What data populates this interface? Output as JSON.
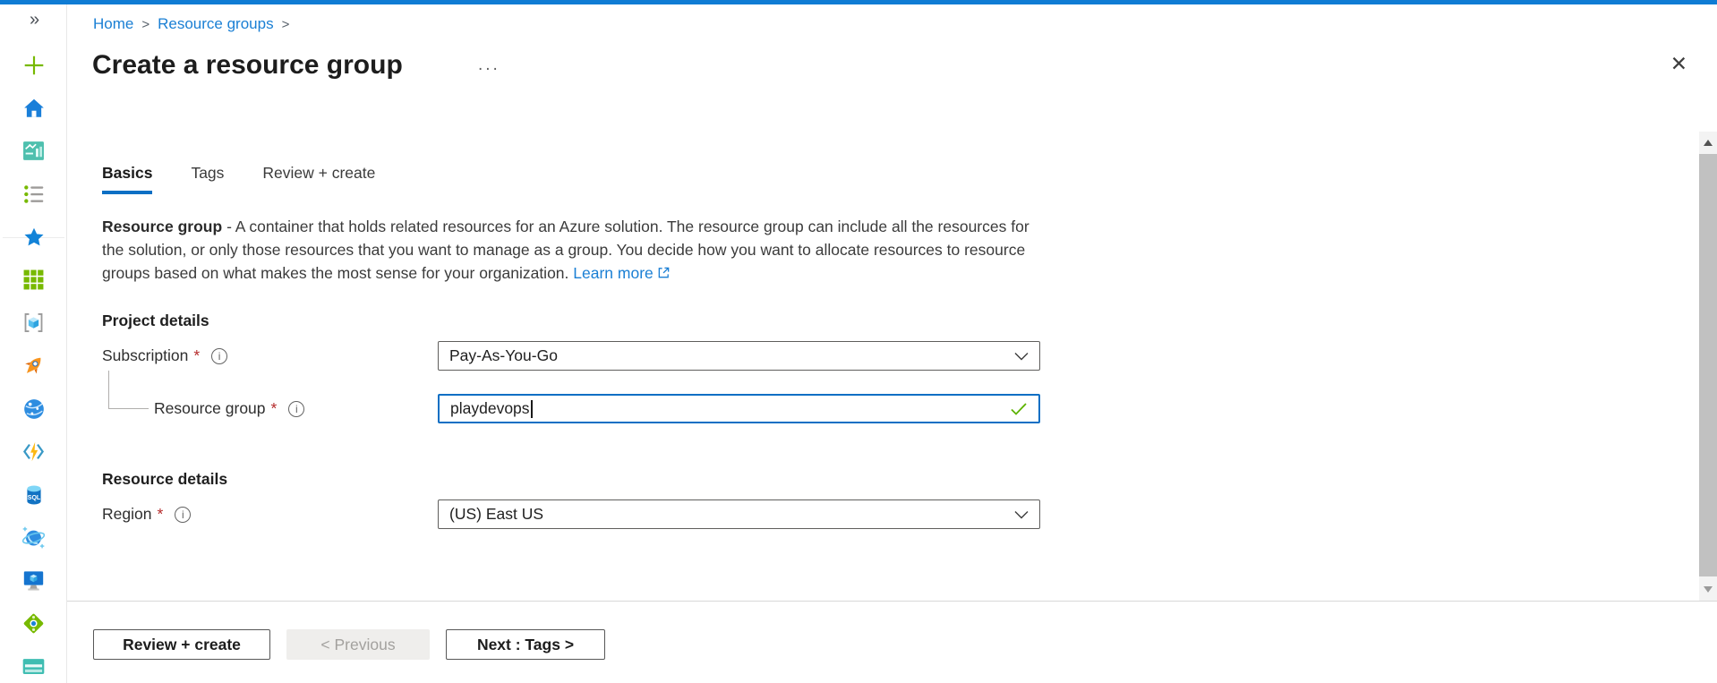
{
  "colors": {
    "accent_blue": "#0f7cd4",
    "link_blue": "#1a7fd4",
    "valid_green": "#5db300",
    "required_red": "#b52b2b"
  },
  "glyphs": {
    "expand": "»",
    "more_options": "...",
    "close": "✕",
    "info": "i",
    "breadcrumb_separator": ">"
  },
  "sidebar": {
    "icons": [
      "plus-icon",
      "home-icon",
      "dashboard-icon",
      "all-services-icon",
      "favorites-star-icon",
      "all-resources-grid-icon",
      "resource-groups-icon",
      "rocket-icon",
      "app-services-globe-icon",
      "function-app-icon",
      "sql-database-icon",
      "cosmos-db-icon",
      "virtual-machine-icon",
      "load-balancer-icon",
      "storage-account-icon"
    ]
  },
  "breadcrumb": {
    "home": "Home",
    "resource_groups": "Resource groups"
  },
  "page": {
    "title": "Create a resource group"
  },
  "tabs": {
    "basics": "Basics",
    "tags": "Tags",
    "review_create": "Review + create"
  },
  "description": {
    "lead": "Resource group",
    "body": " - A container that holds related resources for an Azure solution. The resource group can include all the resources for the solution, or only those resources that you want to manage as a group. You decide how you want to allocate resources to resource groups based on what makes the most sense for your organization. ",
    "link_label": "Learn more"
  },
  "form": {
    "required_mark": "*",
    "project_details_heading": "Project details",
    "subscription": {
      "label": "Subscription",
      "value": "Pay-As-You-Go"
    },
    "resource_group": {
      "label": "Resource group",
      "value": "playdevops"
    },
    "resource_details_heading": "Resource details",
    "region": {
      "label": "Region",
      "value": "(US) East US"
    }
  },
  "footer": {
    "review_create": "Review + create",
    "previous": "< Previous",
    "next": "Next : Tags >"
  }
}
